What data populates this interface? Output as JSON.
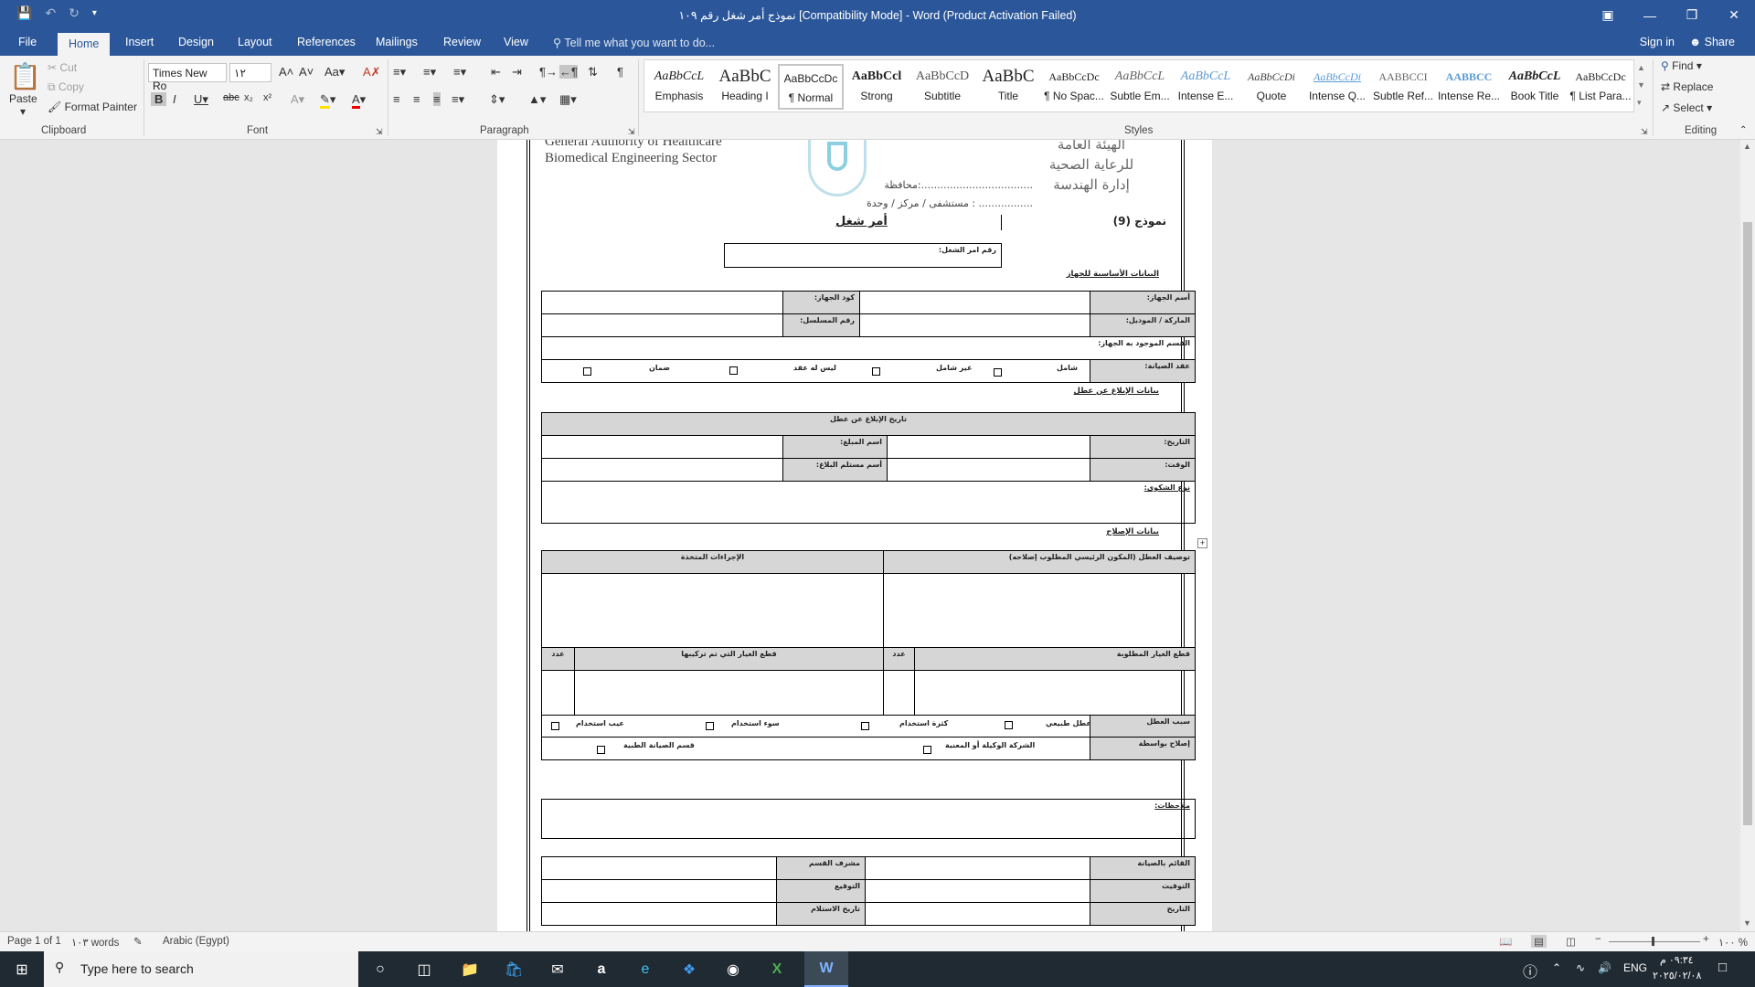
{
  "window": {
    "title": "نموذج أمر شغل رقم ١٠٩ [Compatibility Mode] - Word (Product Activation Failed)"
  },
  "tabs": [
    "File",
    "Home",
    "Insert",
    "Design",
    "Layout",
    "References",
    "Mailings",
    "Review",
    "View"
  ],
  "tell_me": "Tell me what you want to do...",
  "account": {
    "sign_in": "Sign in",
    "share": "Share"
  },
  "clipboard": {
    "paste": "Paste",
    "cut": "Cut",
    "copy": "Copy",
    "format_painter": "Format Painter",
    "label": "Clipboard"
  },
  "font": {
    "name": "Times New Ro",
    "size": "١٢",
    "label": "Font"
  },
  "paragraph": {
    "label": "Paragraph"
  },
  "styles": {
    "label": "Styles",
    "items": [
      {
        "preview": "AaBbCcL",
        "name": "Emphasis"
      },
      {
        "preview": "AaBbC",
        "name": "Heading I"
      },
      {
        "preview": "AaBbCcDc",
        "name": "¶ Normal"
      },
      {
        "preview": "AaBbCcl",
        "name": "Strong"
      },
      {
        "preview": "AaBbCcD",
        "name": "Subtitle"
      },
      {
        "preview": "AaBbC",
        "name": "Title"
      },
      {
        "preview": "AaBbCcDc",
        "name": "¶ No Spac..."
      },
      {
        "preview": "AaBbCcL",
        "name": "Subtle Em..."
      },
      {
        "preview": "AaBbCcL",
        "name": "Intense E..."
      },
      {
        "preview": "AaBbCcDi",
        "name": "Quote"
      },
      {
        "preview": "AaBbCcDi",
        "name": "Intense Q..."
      },
      {
        "preview": "AABBCCI",
        "name": "Subtle Ref..."
      },
      {
        "preview": "AABBCC",
        "name": "Intense Re..."
      },
      {
        "preview": "AaBbCcL",
        "name": "Book Title"
      },
      {
        "preview": "AaBbCcDc",
        "name": "¶ List Para..."
      }
    ]
  },
  "editing": {
    "find": "Find",
    "replace": "Replace",
    "select": "Select",
    "label": "Editing"
  },
  "doc": {
    "hdr_en1": "General Authority of Healthcare",
    "hdr_en2": "Biomedical Engineering Sector",
    "gov": "محافظة:...................................",
    "hosp": "مستشفى / مركز / وحدة : .................",
    "form_no": "نموذج (9)",
    "form_title": "أمر شغل",
    "wo_no": "رقم امر الشغل:",
    "sec_basic": "البيانات الأساسية للجهاز",
    "dev_name": "أسم الجهاز:",
    "dev_code": "كود الجهاز:",
    "brand": "الماركة / الموديل:",
    "serial": "رقم المسلسل:",
    "dept": "القسم الموجود به الجهاز:",
    "contract": "عقد الصيانة:",
    "c_full": "شامل",
    "c_partial": "غير شامل",
    "c_none": "ليس له عقد",
    "c_warranty": "ضمان",
    "sec_report": "بيانات الإبلاغ عن عطل",
    "report_date_hdr": "تاريخ الإبلاغ عن عطل",
    "date": "التاريخ:",
    "reporter": "اسم المبلغ:",
    "time": "الوقت:",
    "receiver": "أسم مستلم البلاغ:",
    "complaint": "نوع الشكوى:",
    "sec_repair": "بيانات الإصلاح",
    "fault_desc": "توصيف العطل (المكون الرئيسي المطلوب إصلاحه)",
    "actions": "الإجراءات المتخذة",
    "parts_req": "قطع الغيار المطلوبة",
    "qty": "عدد",
    "parts_inst": "قطع الغيار التي تم تركيبها",
    "cause": "سبب العطل",
    "natural": "عطل طبيعي",
    "overuse": "كثرة استخدام",
    "misuse": "سوء استخدام",
    "defect": "عيب استخدام",
    "repaired_by": "إصلاح بواسطة",
    "agent": "الشركة الوكيلة أو المعنية",
    "maint_dept": "قسم الصيانة الطبية",
    "notes": "ملاحظات:",
    "maint_staff": "القائم بالصيانة",
    "dept_sup": "مشرف القسم",
    "time2": "التوقيت",
    "signature": "التوقيع",
    "date2": "التاريخ",
    "receipt_date": "تاريخ الاستلام"
  },
  "status": {
    "page": "Page 1 of 1",
    "words": "١٠٣ words",
    "lang": "Arabic (Egypt)",
    "zoom": "١٠٠ %"
  },
  "taskbar": {
    "search": "Type here to search",
    "lang": "ENG",
    "time": "٠٩:٣٤ م",
    "date": "٢٠٢٥/٠٢/٠٨"
  }
}
